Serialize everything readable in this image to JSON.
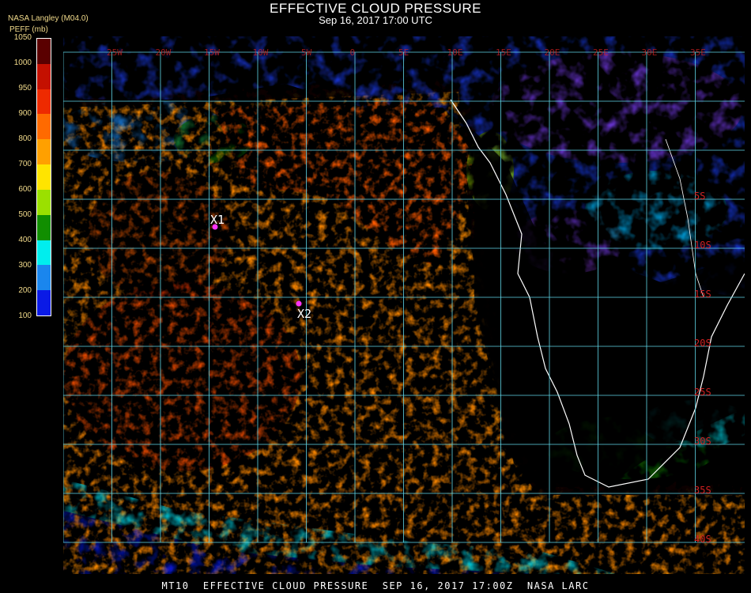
{
  "header": {
    "title": "EFFECTIVE CLOUD PRESSURE",
    "subtitle": "Sep 16, 2017 17:00 UTC",
    "producer": "NASA Langley (M04.0)",
    "parameter": "PEFF (mb)"
  },
  "legend": {
    "ticks": [
      "1050",
      "1000",
      "950",
      "900",
      "800",
      "700",
      "600",
      "500",
      "400",
      "300",
      "200",
      "100"
    ],
    "colors": [
      "#5a0000",
      "#c41000",
      "#ee2a00",
      "#ff6a00",
      "#ffa000",
      "#ffe400",
      "#9be000",
      "#118e00",
      "#00eeee",
      "#1a86ee",
      "#0a1ae6",
      "#8a3ae6"
    ]
  },
  "map": {
    "lat_labels": [
      "5S",
      "10S",
      "15S",
      "20S",
      "25S",
      "30S",
      "35S",
      "40S"
    ],
    "lon_labels": [
      "25W",
      "20W",
      "15W",
      "10W",
      "5W",
      "0",
      "5E",
      "10E",
      "15E",
      "20E",
      "25E",
      "30E",
      "35E"
    ],
    "markers": [
      {
        "label": "X1"
      },
      {
        "label": "X2"
      }
    ],
    "grid_color": "#5fd6e8",
    "label_color": "#d02020",
    "coast_color": "#ffffff"
  },
  "footer": {
    "text": "MT10  EFFECTIVE CLOUD PRESSURE  SEP 16, 2017 17:00Z  NASA LARC"
  }
}
